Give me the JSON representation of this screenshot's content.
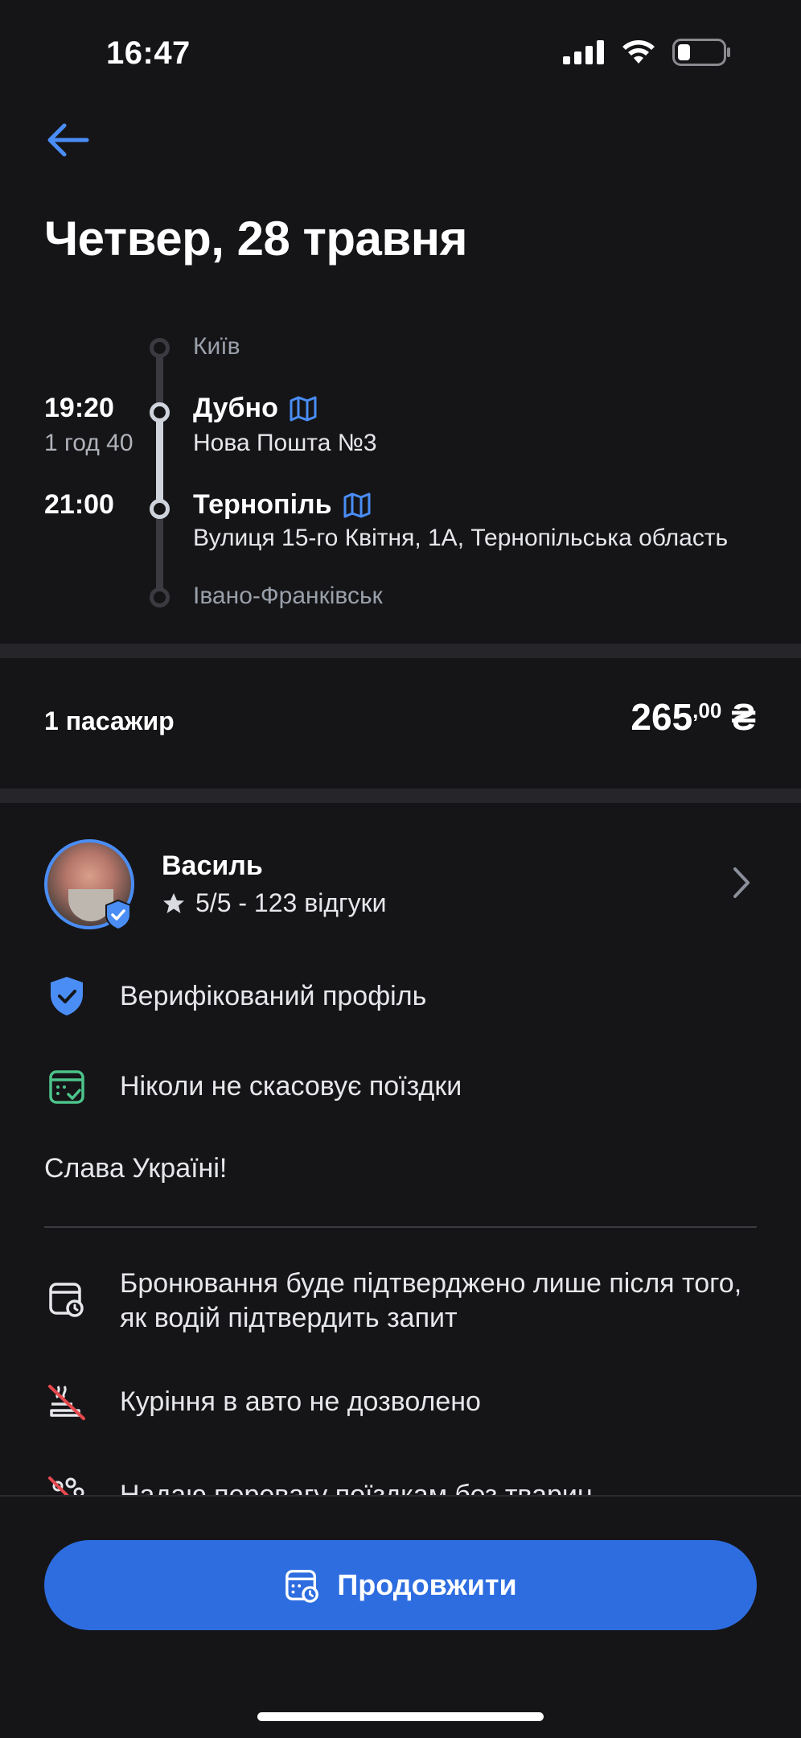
{
  "status": {
    "time": "16:47"
  },
  "header": {
    "title": "Четвер, 28 травня"
  },
  "route": {
    "origin": "Київ",
    "stops": [
      {
        "time": "19:20",
        "duration": "1 год 40",
        "name": "Дубно",
        "address": "Нова Пошта №3"
      },
      {
        "time": "21:00",
        "name": "Тернопіль",
        "address": "Вулиця 15-го Квітня, 1А, Тернопільська область"
      }
    ],
    "destination": "Івано-Франківськ"
  },
  "booking": {
    "passengers": "1 пасажир",
    "price_main": "265",
    "price_cents": ",00",
    "currency": "₴"
  },
  "driver": {
    "name": "Василь",
    "rating": "5/5 - 123 відгуки"
  },
  "features": {
    "verified": "Верифікований профіль",
    "never_cancels": "Ніколи не скасовує поїздки",
    "bio": "Слава Україні!",
    "booking_confirm": "Бронювання буде підтверджено лише після того, як водій підтвердить запит",
    "no_smoking": "Куріння в авто не дозволено",
    "no_pets": "Надаю перевагу поїздкам без тварин"
  },
  "cta": {
    "label": "Продовжити"
  },
  "colors": {
    "accent": "#2e6de0",
    "verified_blue": "#4a8df5",
    "green": "#4cc38a",
    "red": "#e5484d",
    "background": "#151518"
  }
}
